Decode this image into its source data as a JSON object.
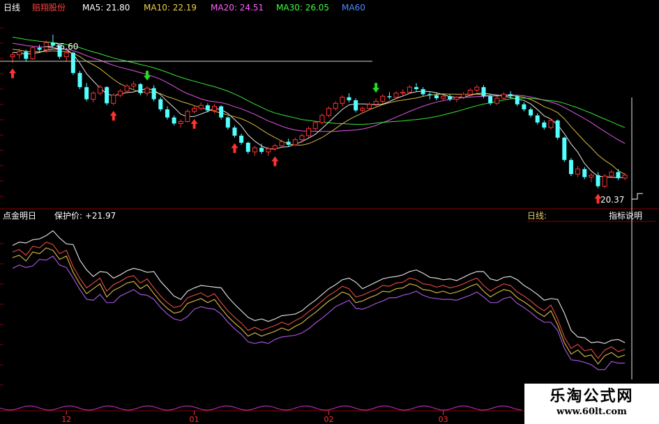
{
  "header": {
    "period": "日线",
    "stock": "赔翔股份",
    "ma": [
      {
        "label": "MA5: 21.80",
        "color": "#ffffff"
      },
      {
        "label": "MA10: 22.19",
        "color": "#f0d048"
      },
      {
        "label": "MA20: 24.51",
        "color": "#ff60ff"
      },
      {
        "label": "MA30: 26.05",
        "color": "#40ff40"
      },
      {
        "label": "MA60",
        "color": "#4c8cff"
      }
    ]
  },
  "colors": {
    "up": "#ff3232",
    "down": "#54ffff",
    "bg": "#000000",
    "grid": "#8b0000",
    "buy_arrow": "#ff3232",
    "sell_arrow": "#22dd22"
  },
  "chart_data": [
    {
      "type": "candlestick",
      "name": "赔翔股份 日线",
      "ylim": [
        18.5,
        37.5
      ],
      "annotations": {
        "high": "35.60",
        "low": "20.37"
      },
      "x_ticks": [
        "12",
        "01",
        "02",
        "03",
        "04"
      ],
      "x_tick_indices": [
        8,
        27,
        47,
        64,
        84
      ],
      "candles": [
        [
          33.4,
          33.8,
          32.8,
          33.6
        ],
        [
          33.6,
          34.2,
          33.2,
          33.9
        ],
        [
          33.9,
          34.1,
          32.9,
          33.2
        ],
        [
          33.2,
          34.5,
          33.1,
          34.3
        ],
        [
          34.3,
          34.6,
          33.9,
          34.1
        ],
        [
          34.1,
          35.0,
          33.8,
          34.8
        ],
        [
          34.8,
          35.6,
          34.3,
          34.5
        ],
        [
          34.5,
          34.7,
          33.2,
          33.4
        ],
        [
          33.4,
          34.0,
          32.9,
          33.8
        ],
        [
          33.8,
          33.9,
          31.6,
          31.8
        ],
        [
          31.8,
          32.0,
          30.2,
          30.4
        ],
        [
          30.4,
          30.8,
          29.0,
          29.2
        ],
        [
          29.2,
          30.0,
          28.9,
          29.8
        ],
        [
          29.8,
          30.6,
          29.6,
          30.4
        ],
        [
          30.4,
          30.5,
          28.6,
          28.8
        ],
        [
          28.8,
          29.8,
          28.6,
          29.6
        ],
        [
          29.6,
          30.2,
          29.4,
          30.0
        ],
        [
          30.0,
          30.7,
          29.8,
          30.5
        ],
        [
          30.5,
          31.0,
          30.2,
          30.7
        ],
        [
          30.7,
          30.8,
          29.6,
          29.8
        ],
        [
          29.8,
          30.5,
          29.5,
          30.3
        ],
        [
          30.3,
          30.6,
          29.0,
          29.2
        ],
        [
          29.2,
          29.4,
          28.0,
          28.2
        ],
        [
          28.2,
          28.5,
          27.2,
          27.4
        ],
        [
          27.4,
          27.6,
          26.6,
          26.8
        ],
        [
          26.8,
          27.2,
          26.4,
          27.0
        ],
        [
          27.0,
          28.2,
          26.9,
          28.0
        ],
        [
          28.0,
          28.6,
          27.8,
          28.3
        ],
        [
          28.3,
          28.9,
          28.1,
          28.6
        ],
        [
          28.6,
          28.8,
          27.9,
          28.1
        ],
        [
          28.1,
          28.7,
          27.8,
          28.5
        ],
        [
          28.5,
          28.6,
          27.2,
          27.4
        ],
        [
          27.4,
          27.5,
          26.2,
          26.4
        ],
        [
          26.4,
          26.6,
          25.4,
          25.6
        ],
        [
          25.6,
          25.8,
          24.7,
          24.9
        ],
        [
          24.9,
          25.0,
          23.8,
          24.0
        ],
        [
          24.0,
          24.6,
          23.6,
          24.4
        ],
        [
          24.4,
          24.8,
          23.8,
          24.0
        ],
        [
          24.0,
          24.5,
          23.6,
          24.3
        ],
        [
          24.3,
          24.8,
          24.1,
          24.6
        ],
        [
          24.6,
          25.2,
          24.4,
          25.0
        ],
        [
          25.0,
          25.3,
          24.5,
          24.7
        ],
        [
          24.7,
          25.4,
          24.6,
          25.2
        ],
        [
          25.2,
          25.8,
          24.9,
          25.6
        ],
        [
          25.6,
          26.5,
          25.4,
          26.3
        ],
        [
          26.3,
          27.1,
          26.1,
          26.9
        ],
        [
          26.9,
          27.8,
          26.7,
          27.6
        ],
        [
          27.6,
          28.5,
          27.4,
          28.3
        ],
        [
          28.3,
          29.0,
          28.1,
          28.8
        ],
        [
          28.8,
          29.6,
          28.5,
          29.4
        ],
        [
          29.4,
          29.8,
          28.9,
          29.1
        ],
        [
          29.1,
          29.3,
          27.9,
          28.1
        ],
        [
          28.1,
          28.5,
          27.8,
          28.3
        ],
        [
          28.3,
          28.9,
          28.1,
          28.7
        ],
        [
          28.7,
          29.3,
          28.5,
          29.0
        ],
        [
          29.0,
          29.7,
          28.8,
          29.5
        ],
        [
          29.5,
          29.9,
          29.2,
          29.4
        ],
        [
          29.4,
          30.0,
          29.2,
          29.8
        ],
        [
          29.8,
          30.2,
          29.5,
          29.9
        ],
        [
          29.9,
          30.6,
          29.7,
          30.4
        ],
        [
          30.4,
          30.8,
          30.0,
          30.2
        ],
        [
          30.2,
          30.4,
          29.5,
          29.7
        ],
        [
          29.7,
          29.9,
          29.2,
          29.6
        ],
        [
          29.6,
          29.8,
          29.1,
          29.3
        ],
        [
          29.3,
          29.6,
          29.0,
          29.5
        ],
        [
          29.5,
          29.7,
          29.0,
          29.2
        ],
        [
          29.2,
          29.5,
          28.9,
          29.4
        ],
        [
          29.4,
          29.9,
          29.2,
          29.7
        ],
        [
          29.7,
          30.3,
          29.5,
          30.1
        ],
        [
          30.1,
          30.6,
          29.9,
          30.4
        ],
        [
          30.4,
          30.6,
          29.3,
          29.5
        ],
        [
          29.5,
          29.7,
          28.6,
          28.8
        ],
        [
          28.8,
          29.5,
          28.6,
          29.3
        ],
        [
          29.3,
          29.9,
          29.1,
          29.7
        ],
        [
          29.7,
          30.0,
          29.3,
          29.5
        ],
        [
          29.5,
          29.6,
          28.5,
          28.7
        ],
        [
          28.7,
          28.9,
          28.0,
          28.2
        ],
        [
          28.2,
          28.4,
          27.4,
          27.6
        ],
        [
          27.6,
          27.8,
          26.7,
          26.9
        ],
        [
          26.9,
          27.1,
          26.2,
          26.4
        ],
        [
          26.4,
          27.3,
          26.2,
          27.1
        ],
        [
          27.1,
          27.2,
          25.2,
          25.4
        ],
        [
          25.4,
          25.5,
          23.0,
          23.2
        ],
        [
          23.2,
          23.4,
          21.6,
          21.8
        ],
        [
          21.8,
          22.6,
          21.5,
          22.3
        ],
        [
          22.3,
          22.5,
          21.3,
          21.5
        ],
        [
          21.5,
          21.9,
          21.0,
          21.7
        ],
        [
          21.7,
          22.0,
          20.4,
          20.6
        ],
        [
          20.6,
          21.8,
          20.4,
          21.6
        ],
        [
          21.6,
          22.2,
          21.4,
          22.0
        ],
        [
          22.0,
          22.3,
          21.2,
          21.4
        ],
        [
          21.4,
          21.9,
          21.2,
          21.7
        ]
      ],
      "buy_signals": [
        0,
        15,
        27,
        33,
        39,
        87
      ],
      "sell_signals": [
        20,
        54
      ]
    },
    {
      "type": "line",
      "name": "点金明日",
      "label": "点金明日",
      "value_label": "保护价: +21.97",
      "legend_tag": "日线:",
      "legend_link": "指标说明",
      "note": "series values are the same day's high/close/low/open of the candle chart plotted above"
    }
  ]
}
